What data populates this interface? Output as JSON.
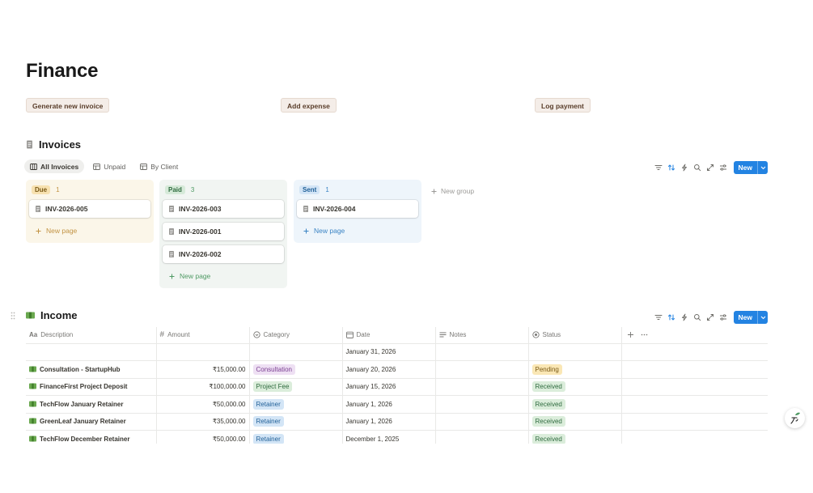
{
  "page": {
    "title": "Finance"
  },
  "actions": [
    {
      "label": "Generate new invoice"
    },
    {
      "label": "Add expense"
    },
    {
      "label": "Log payment"
    }
  ],
  "invoices": {
    "title": "Invoices",
    "views": [
      {
        "label": "All Invoices",
        "icon": "board-icon",
        "active": true
      },
      {
        "label": "Unpaid",
        "icon": "table-icon"
      },
      {
        "label": "By Client",
        "icon": "table-icon"
      }
    ],
    "new_label": "New",
    "groups": [
      {
        "name": "Due",
        "count": "1",
        "cards": [
          "INV-2026-005"
        ],
        "new_page": "New page",
        "colors": {
          "bg": "#fbf6e9",
          "pill": "#f7e1b0",
          "pill_text": "#7a5a17",
          "count": "#c29343",
          "newpage": "#c29343"
        }
      },
      {
        "name": "Paid",
        "count": "3",
        "cards": [
          "INV-2026-003",
          "INV-2026-001",
          "INV-2026-002"
        ],
        "new_page": "New page",
        "colors": {
          "bg": "#f1f5f2",
          "pill": "#d6ead9",
          "pill_text": "#2f6b3f",
          "count": "#4f9a64",
          "newpage": "#4f9a64"
        }
      },
      {
        "name": "Sent",
        "count": "1",
        "cards": [
          "INV-2026-004"
        ],
        "new_page": "New page",
        "colors": {
          "bg": "#eef5fb",
          "pill": "#d3e5f6",
          "pill_text": "#1f5f97",
          "count": "#3b84c4",
          "newpage": "#3b84c4"
        }
      }
    ],
    "new_group": "New group"
  },
  "income": {
    "title": "Income",
    "new_label": "New",
    "columns": [
      "Description",
      "Amount",
      "Category",
      "Date",
      "Notes",
      "Status"
    ],
    "rows": [
      {
        "description": "",
        "amount": "",
        "category": "",
        "date": "January 31, 2026",
        "notes": "",
        "status": ""
      },
      {
        "description": "Consultation - StartupHub",
        "amount": "₹15,000.00",
        "category": "Consultation",
        "date": "January 20, 2026",
        "notes": "",
        "status": "Pending"
      },
      {
        "description": "FinanceFirst Project Deposit",
        "amount": "₹100,000.00",
        "category": "Project Fee",
        "date": "January 15, 2026",
        "notes": "",
        "status": "Received"
      },
      {
        "description": "TechFlow January Retainer",
        "amount": "₹50,000.00",
        "category": "Retainer",
        "date": "January 1, 2026",
        "notes": "",
        "status": "Received"
      },
      {
        "description": "GreenLeaf January Retainer",
        "amount": "₹35,000.00",
        "category": "Retainer",
        "date": "January 1, 2026",
        "notes": "",
        "status": "Received"
      },
      {
        "description": "TechFlow December Retainer",
        "amount": "₹50,000.00",
        "category": "Retainer",
        "date": "December 1, 2025",
        "notes": "",
        "status": "Received"
      }
    ],
    "tag_colors": {
      "Consultation": {
        "bg": "#eee0f3",
        "fg": "#7b3f93"
      },
      "Project Fee": {
        "bg": "#dbeddb",
        "fg": "#2f6b3f"
      },
      "Retainer": {
        "bg": "#d3e5f6",
        "fg": "#1f5f97"
      },
      "Pending": {
        "bg": "#fae7b5",
        "fg": "#7a5a17"
      },
      "Received": {
        "bg": "#dbeddb",
        "fg": "#2f6b3f"
      }
    }
  },
  "accent": "#2383e2"
}
